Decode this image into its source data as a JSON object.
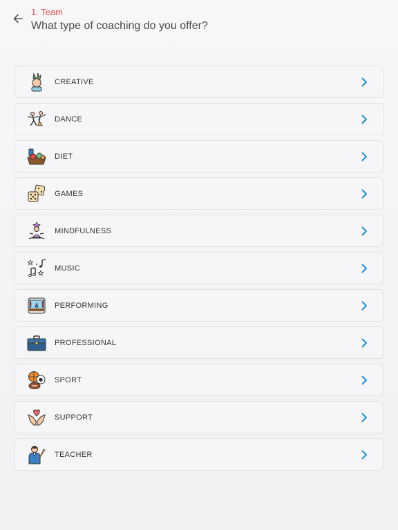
{
  "header": {
    "step_label": "1. Team",
    "question": "What type of coaching do you offer?"
  },
  "accent_color": "#e8504a",
  "chevron_color": "#1f8fd6",
  "categories": [
    {
      "label": "CREATIVE",
      "icon": "creative-icon"
    },
    {
      "label": "DANCE",
      "icon": "dance-icon"
    },
    {
      "label": "DIET",
      "icon": "diet-icon"
    },
    {
      "label": "GAMES",
      "icon": "dice-icon"
    },
    {
      "label": "MINDFULNESS",
      "icon": "meditation-icon"
    },
    {
      "label": "MUSIC",
      "icon": "music-notes-icon"
    },
    {
      "label": "PERFORMING",
      "icon": "stage-icon"
    },
    {
      "label": "PROFESSIONAL",
      "icon": "briefcase-icon"
    },
    {
      "label": "SPORT",
      "icon": "sports-balls-icon"
    },
    {
      "label": "SUPPORT",
      "icon": "heart-hands-icon"
    },
    {
      "label": "TEACHER",
      "icon": "teacher-icon"
    }
  ]
}
